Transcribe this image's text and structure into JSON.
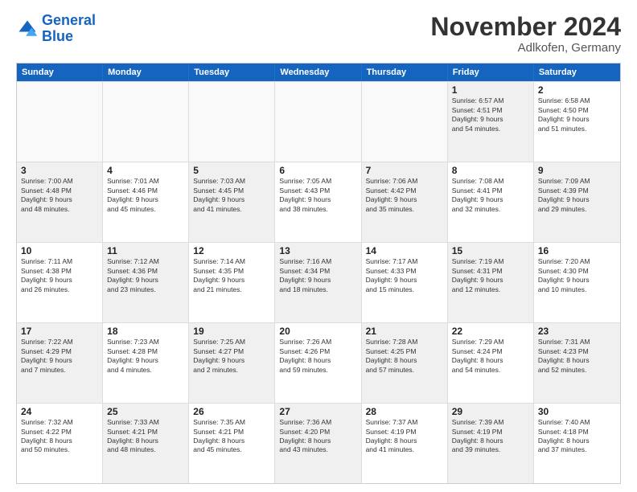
{
  "logo": {
    "line1": "General",
    "line2": "Blue"
  },
  "title": "November 2024",
  "subtitle": "Adlkofen, Germany",
  "header": {
    "days": [
      "Sunday",
      "Monday",
      "Tuesday",
      "Wednesday",
      "Thursday",
      "Friday",
      "Saturday"
    ]
  },
  "weeks": [
    [
      {
        "day": "",
        "info": "",
        "empty": true
      },
      {
        "day": "",
        "info": "",
        "empty": true
      },
      {
        "day": "",
        "info": "",
        "empty": true
      },
      {
        "day": "",
        "info": "",
        "empty": true
      },
      {
        "day": "",
        "info": "",
        "empty": true
      },
      {
        "day": "1",
        "info": "Sunrise: 6:57 AM\nSunset: 4:51 PM\nDaylight: 9 hours\nand 54 minutes.",
        "shaded": true
      },
      {
        "day": "2",
        "info": "Sunrise: 6:58 AM\nSunset: 4:50 PM\nDaylight: 9 hours\nand 51 minutes."
      }
    ],
    [
      {
        "day": "3",
        "info": "Sunrise: 7:00 AM\nSunset: 4:48 PM\nDaylight: 9 hours\nand 48 minutes.",
        "shaded": true
      },
      {
        "day": "4",
        "info": "Sunrise: 7:01 AM\nSunset: 4:46 PM\nDaylight: 9 hours\nand 45 minutes."
      },
      {
        "day": "5",
        "info": "Sunrise: 7:03 AM\nSunset: 4:45 PM\nDaylight: 9 hours\nand 41 minutes.",
        "shaded": true
      },
      {
        "day": "6",
        "info": "Sunrise: 7:05 AM\nSunset: 4:43 PM\nDaylight: 9 hours\nand 38 minutes."
      },
      {
        "day": "7",
        "info": "Sunrise: 7:06 AM\nSunset: 4:42 PM\nDaylight: 9 hours\nand 35 minutes.",
        "shaded": true
      },
      {
        "day": "8",
        "info": "Sunrise: 7:08 AM\nSunset: 4:41 PM\nDaylight: 9 hours\nand 32 minutes."
      },
      {
        "day": "9",
        "info": "Sunrise: 7:09 AM\nSunset: 4:39 PM\nDaylight: 9 hours\nand 29 minutes.",
        "shaded": true
      }
    ],
    [
      {
        "day": "10",
        "info": "Sunrise: 7:11 AM\nSunset: 4:38 PM\nDaylight: 9 hours\nand 26 minutes."
      },
      {
        "day": "11",
        "info": "Sunrise: 7:12 AM\nSunset: 4:36 PM\nDaylight: 9 hours\nand 23 minutes.",
        "shaded": true
      },
      {
        "day": "12",
        "info": "Sunrise: 7:14 AM\nSunset: 4:35 PM\nDaylight: 9 hours\nand 21 minutes."
      },
      {
        "day": "13",
        "info": "Sunrise: 7:16 AM\nSunset: 4:34 PM\nDaylight: 9 hours\nand 18 minutes.",
        "shaded": true
      },
      {
        "day": "14",
        "info": "Sunrise: 7:17 AM\nSunset: 4:33 PM\nDaylight: 9 hours\nand 15 minutes."
      },
      {
        "day": "15",
        "info": "Sunrise: 7:19 AM\nSunset: 4:31 PM\nDaylight: 9 hours\nand 12 minutes.",
        "shaded": true
      },
      {
        "day": "16",
        "info": "Sunrise: 7:20 AM\nSunset: 4:30 PM\nDaylight: 9 hours\nand 10 minutes."
      }
    ],
    [
      {
        "day": "17",
        "info": "Sunrise: 7:22 AM\nSunset: 4:29 PM\nDaylight: 9 hours\nand 7 minutes.",
        "shaded": true
      },
      {
        "day": "18",
        "info": "Sunrise: 7:23 AM\nSunset: 4:28 PM\nDaylight: 9 hours\nand 4 minutes."
      },
      {
        "day": "19",
        "info": "Sunrise: 7:25 AM\nSunset: 4:27 PM\nDaylight: 9 hours\nand 2 minutes.",
        "shaded": true
      },
      {
        "day": "20",
        "info": "Sunrise: 7:26 AM\nSunset: 4:26 PM\nDaylight: 8 hours\nand 59 minutes."
      },
      {
        "day": "21",
        "info": "Sunrise: 7:28 AM\nSunset: 4:25 PM\nDaylight: 8 hours\nand 57 minutes.",
        "shaded": true
      },
      {
        "day": "22",
        "info": "Sunrise: 7:29 AM\nSunset: 4:24 PM\nDaylight: 8 hours\nand 54 minutes."
      },
      {
        "day": "23",
        "info": "Sunrise: 7:31 AM\nSunset: 4:23 PM\nDaylight: 8 hours\nand 52 minutes.",
        "shaded": true
      }
    ],
    [
      {
        "day": "24",
        "info": "Sunrise: 7:32 AM\nSunset: 4:22 PM\nDaylight: 8 hours\nand 50 minutes."
      },
      {
        "day": "25",
        "info": "Sunrise: 7:33 AM\nSunset: 4:21 PM\nDaylight: 8 hours\nand 48 minutes.",
        "shaded": true
      },
      {
        "day": "26",
        "info": "Sunrise: 7:35 AM\nSunset: 4:21 PM\nDaylight: 8 hours\nand 45 minutes."
      },
      {
        "day": "27",
        "info": "Sunrise: 7:36 AM\nSunset: 4:20 PM\nDaylight: 8 hours\nand 43 minutes.",
        "shaded": true
      },
      {
        "day": "28",
        "info": "Sunrise: 7:37 AM\nSunset: 4:19 PM\nDaylight: 8 hours\nand 41 minutes."
      },
      {
        "day": "29",
        "info": "Sunrise: 7:39 AM\nSunset: 4:19 PM\nDaylight: 8 hours\nand 39 minutes.",
        "shaded": true
      },
      {
        "day": "30",
        "info": "Sunrise: 7:40 AM\nSunset: 4:18 PM\nDaylight: 8 hours\nand 37 minutes."
      }
    ]
  ]
}
